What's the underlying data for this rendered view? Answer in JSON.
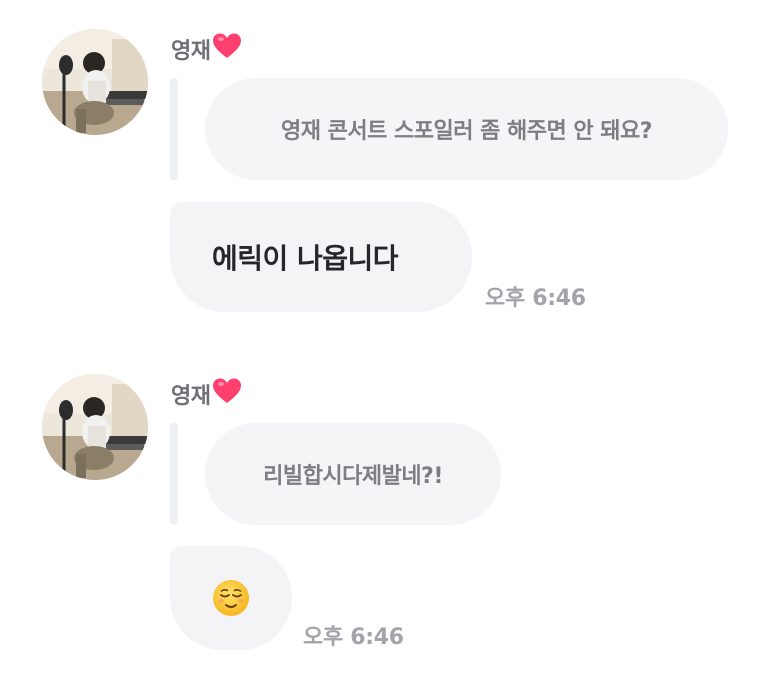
{
  "messages": [
    {
      "sender": "영재",
      "sender_emoji": "heart",
      "quoted_text": "영재 콘서트 스포일러 좀 해주면 안 돼요?",
      "reply_text": "에릭이 나옵니다",
      "timestamp": "오후 6:46"
    },
    {
      "sender": "영재",
      "sender_emoji": "heart",
      "quoted_text": "리빌합시다제발네?!",
      "reply_text": "",
      "reply_emoji": "relieved-face",
      "timestamp": "오후 6:46"
    }
  ],
  "colors": {
    "bubble_bg": "#f4f4f6",
    "quote_bubble_bg": "#f5f5f7",
    "quote_bar": "#eeeff2",
    "name_text": "#6f6f76",
    "quote_text": "#7d7d84",
    "reply_text": "#26262b",
    "timestamp_text": "#a3a3aa",
    "heart": "#ff3f6e"
  }
}
